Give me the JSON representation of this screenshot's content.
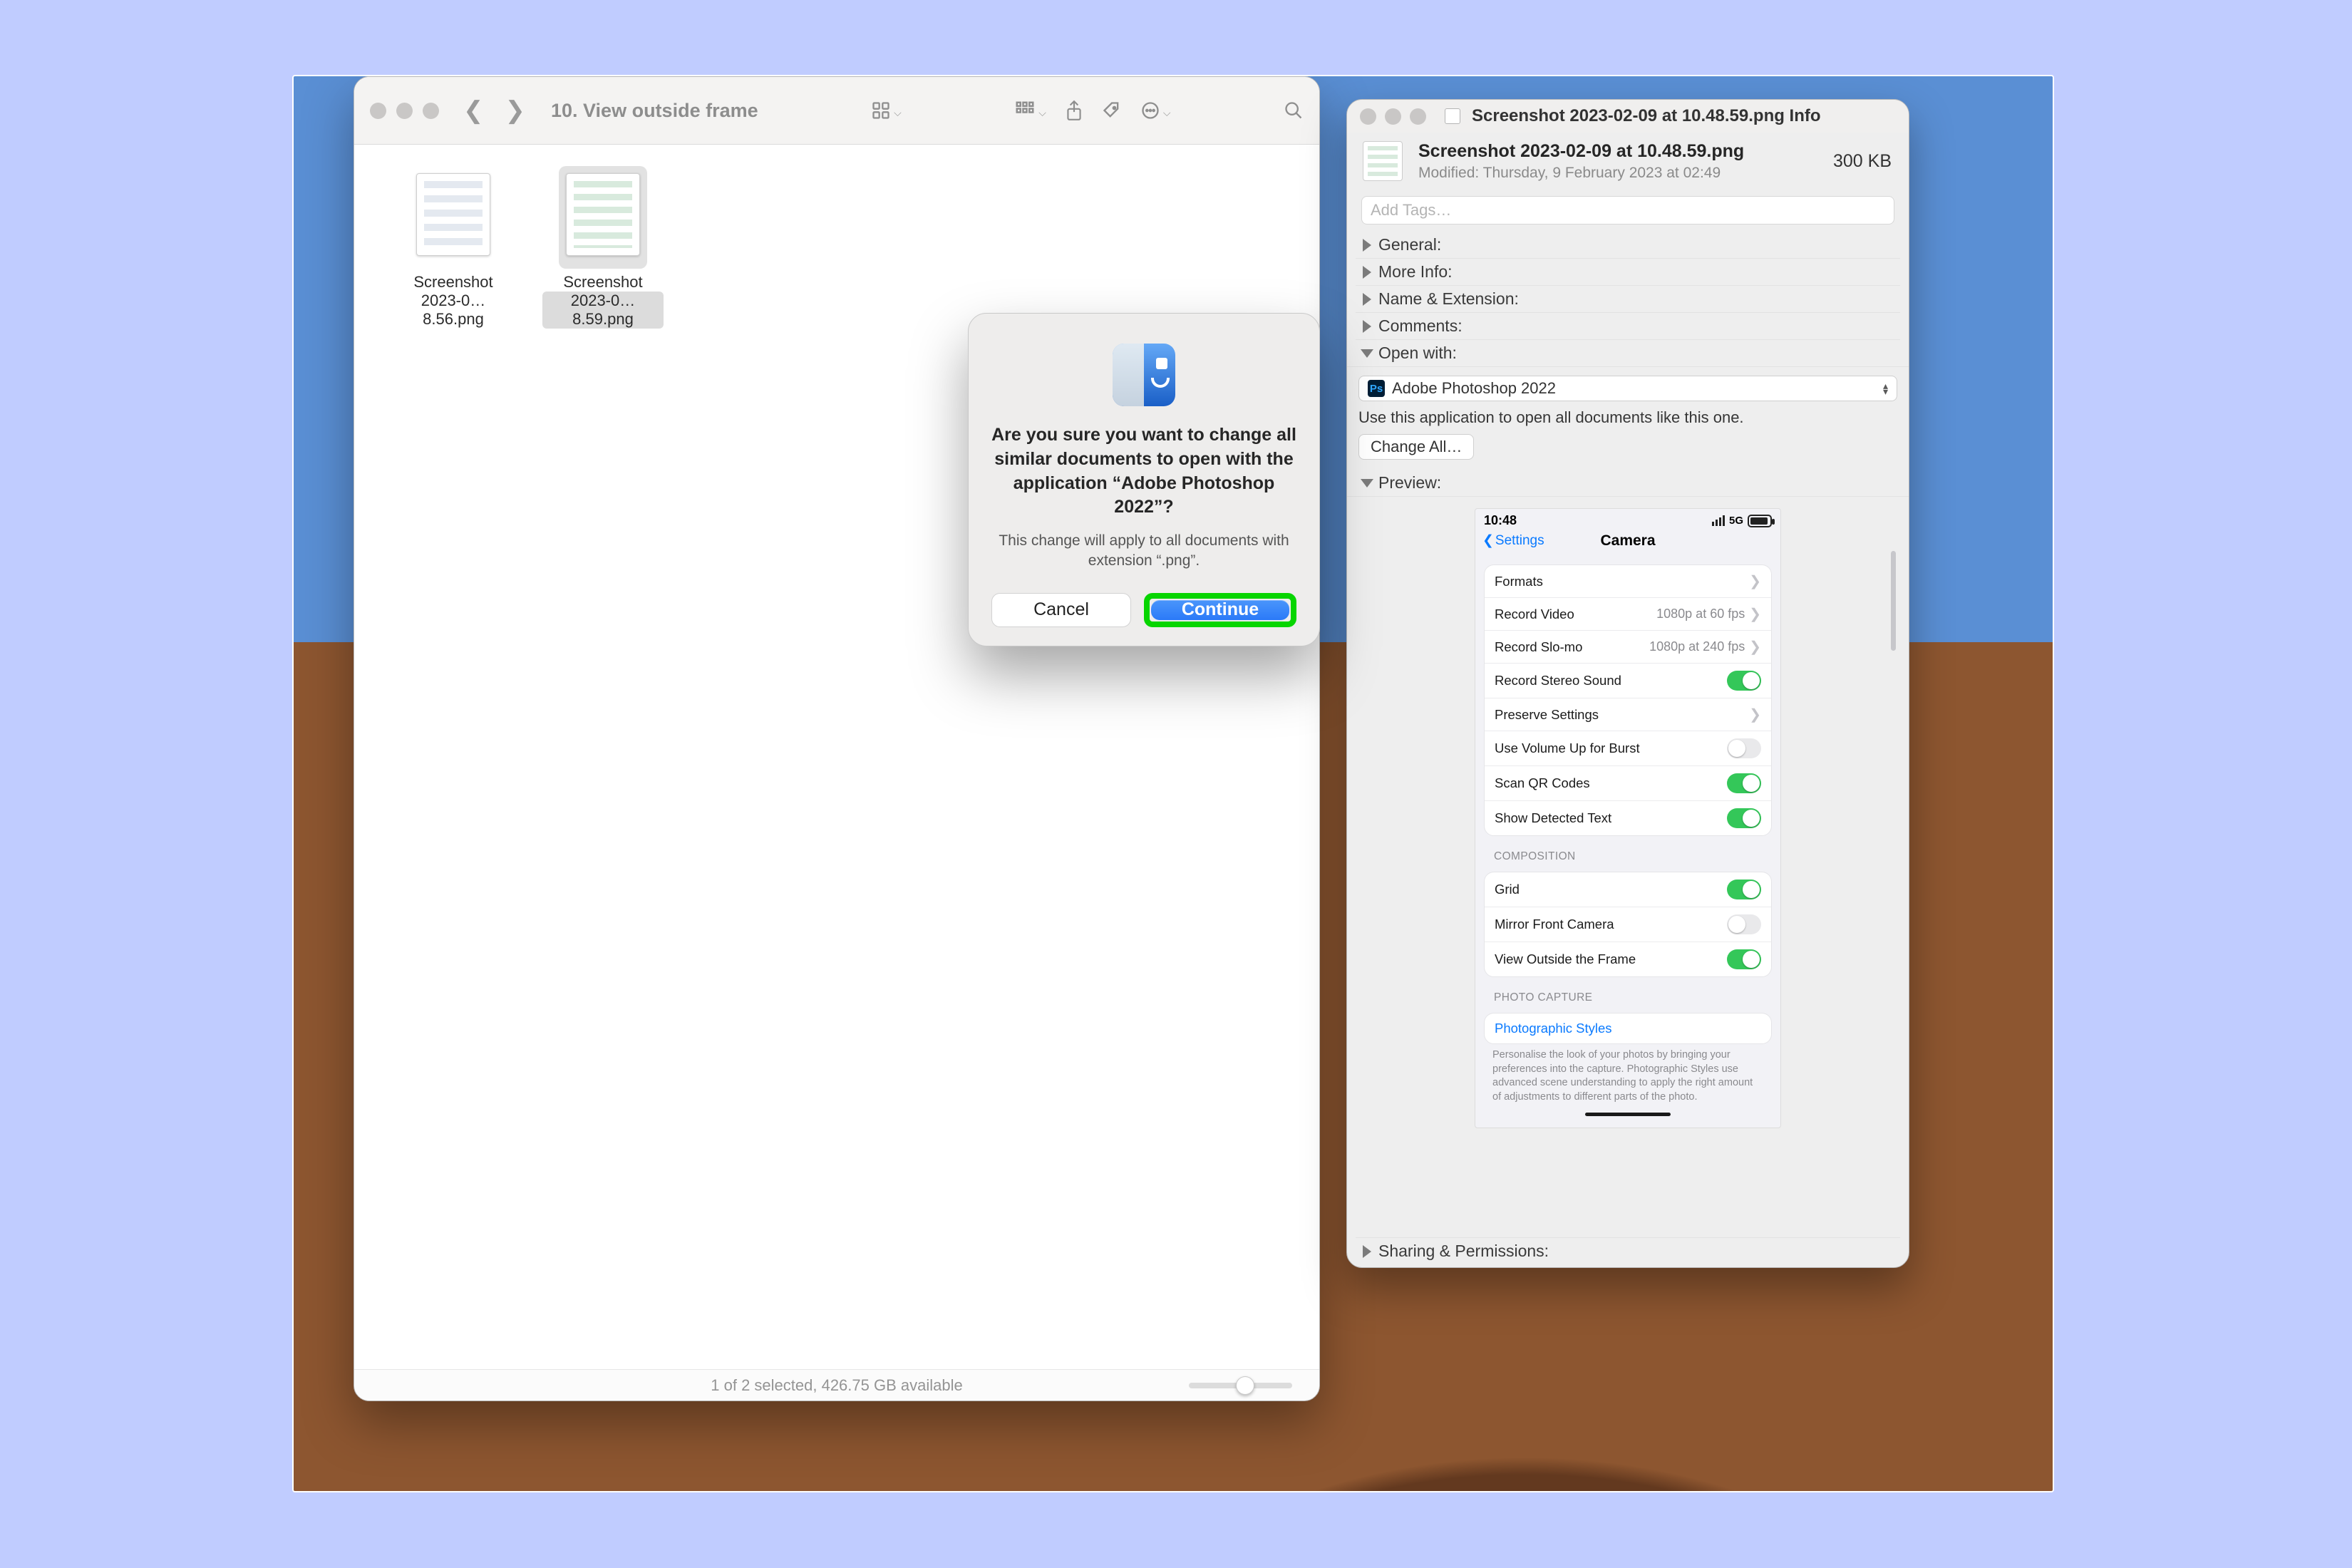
{
  "finder": {
    "title": "10. View outside frame",
    "files": [
      {
        "line1": "Screenshot",
        "line2": "2023-0…8.56.png"
      },
      {
        "line1": "Screenshot",
        "line2": "2023-0…8.59.png"
      }
    ],
    "status": "1 of 2 selected, 426.75 GB available"
  },
  "dialog": {
    "heading": "Are you sure you want to change all similar documents to open with the application “Adobe Photoshop 2022”?",
    "sub": "This change will apply to all documents with extension “.png”.",
    "cancel": "Cancel",
    "continue": "Continue"
  },
  "info": {
    "titlebar": "Screenshot 2023-02-09 at 10.48.59.png Info",
    "filename": "Screenshot 2023-02-09 at 10.48.59.png",
    "size": "300 KB",
    "modified": "Modified: Thursday, 9 February 2023 at 02:49",
    "add_tags_placeholder": "Add Tags…",
    "sections": {
      "general": "General:",
      "more": "More Info:",
      "nameext": "Name & Extension:",
      "comments": "Comments:",
      "openwith": "Open with:",
      "preview": "Preview:",
      "sharing": "Sharing & Permissions:"
    },
    "open_app": "Adobe Photoshop 2022",
    "ps_abbrev": "Ps",
    "open_helper": "Use this application to open all documents like this one.",
    "change_all": "Change All…"
  },
  "phone": {
    "time": "10:48",
    "net": "5G",
    "batt": "87",
    "back": "Settings",
    "title": "Camera",
    "rows": {
      "formats": "Formats",
      "rec_video": "Record Video",
      "rec_video_v": "1080p at 60 fps",
      "rec_slomo": "Record Slo-mo",
      "rec_slomo_v": "1080p at 240 fps",
      "stereo": "Record Stereo Sound",
      "preserve": "Preserve Settings",
      "vol_burst": "Use Volume Up for Burst",
      "qr": "Scan QR Codes",
      "detected": "Show Detected Text"
    },
    "composition_h": "COMPOSITION",
    "comp": {
      "grid": "Grid",
      "mirror": "Mirror Front Camera",
      "outside": "View Outside the Frame"
    },
    "capture_h": "PHOTO CAPTURE",
    "styles": "Photographic Styles",
    "styles_note": "Personalise the look of your photos by bringing your preferences into the capture. Photographic Styles use advanced scene understanding to apply the right amount of adjustments to different parts of the photo."
  }
}
